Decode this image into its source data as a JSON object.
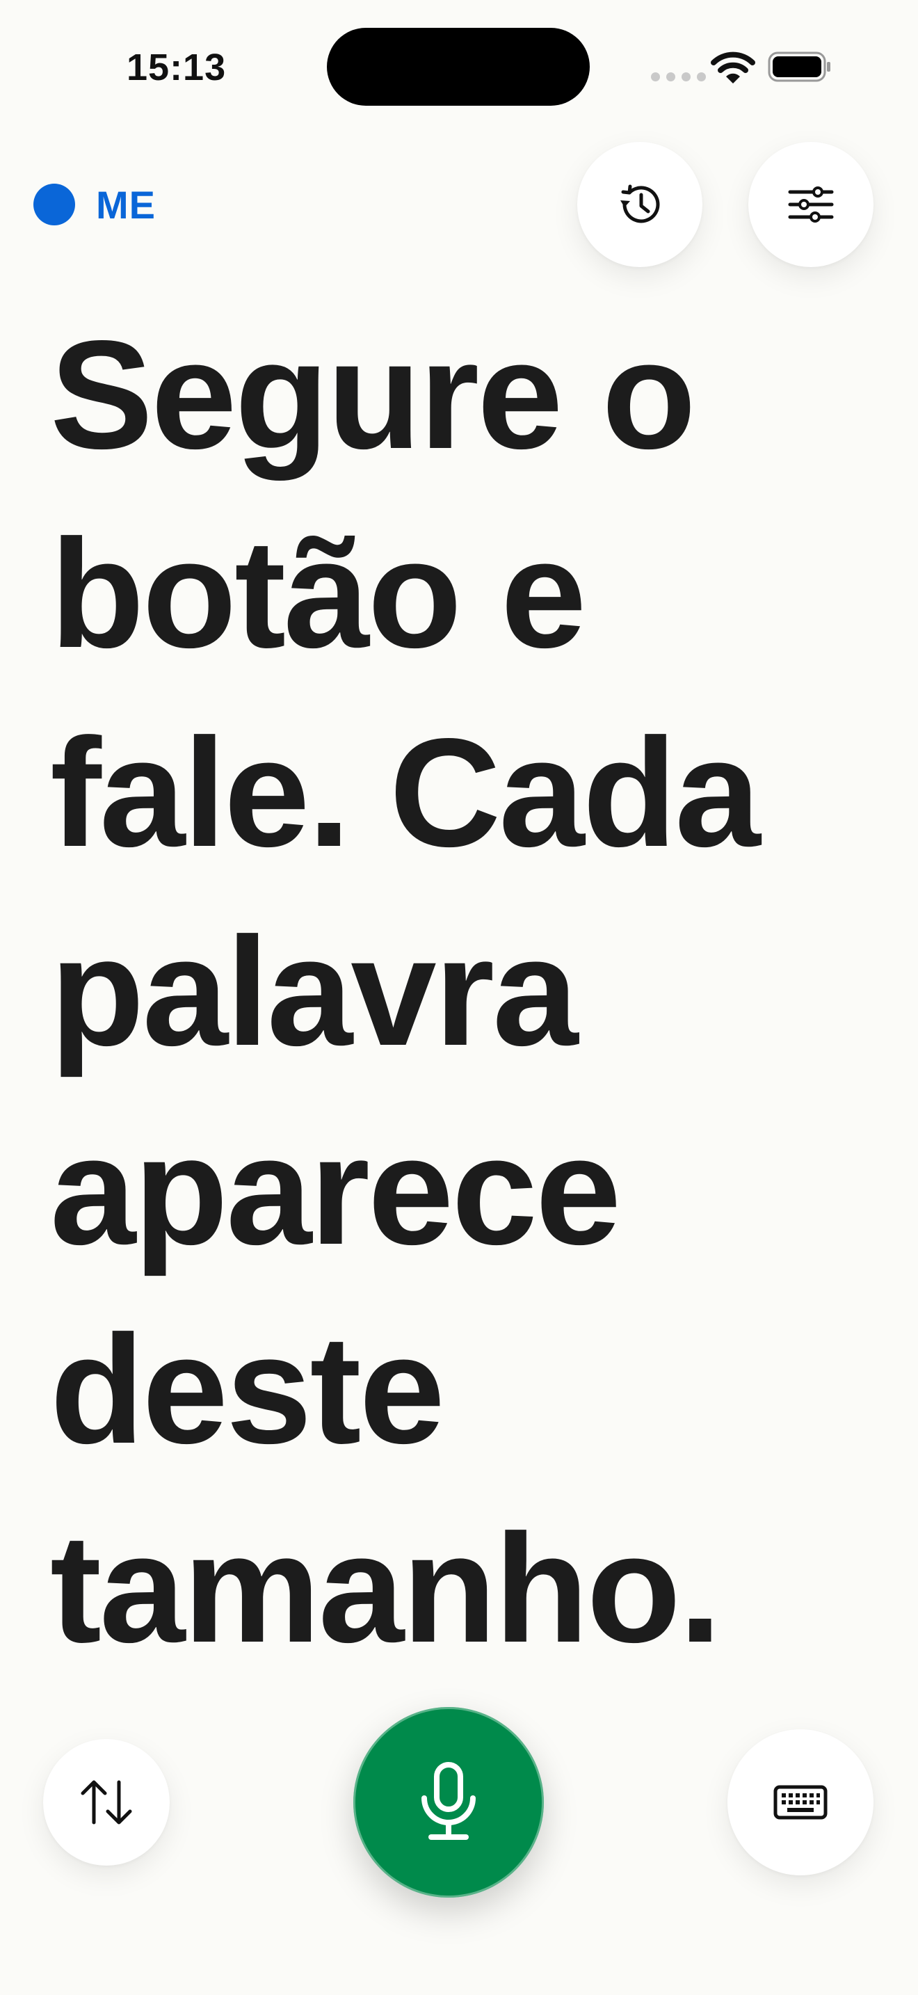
{
  "status_bar": {
    "time": "15:13"
  },
  "header": {
    "speaker_label": "ME",
    "speaker_color": "#0A66D8",
    "history_icon": "history-clock-icon",
    "settings_icon": "sliders-icon"
  },
  "main": {
    "transcript_text": "Segure o botão e fale. Cada palavra aparece deste tamanho."
  },
  "bottom_bar": {
    "swap_icon": "swap-arrows-icon",
    "mic_icon": "microphone-icon",
    "mic_color": "#008A4B",
    "keyboard_icon": "keyboard-icon"
  }
}
